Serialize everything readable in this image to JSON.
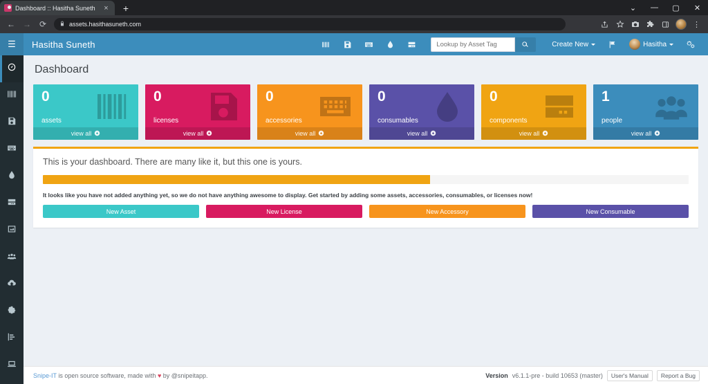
{
  "browser": {
    "tab": {
      "title": "Dashboard :: Hasitha Suneth",
      "favicon": "snipeit-favicon",
      "close": "×"
    },
    "new_tab": "+",
    "window_controls": {
      "minimize_group": "⌄",
      "minimize": "—",
      "maximize": "▢",
      "close": "✕"
    },
    "nav": {
      "back": "←",
      "forward": "→",
      "reload": "⟳"
    },
    "omnibox": {
      "lock": "🔒",
      "url": "assets.hasithasuneth.com"
    },
    "toolbar_icons": [
      "share-icon",
      "bookmark-star-icon",
      "screenshot-camera-icon",
      "extensions-puzzle-icon",
      "side-panel-icon",
      "profile-avatar",
      "chrome-menu-icon"
    ]
  },
  "sidebar": {
    "toggle": {
      "name": "menu-toggle",
      "glyph": "☰"
    },
    "items": [
      {
        "name": "dashboard",
        "icon": "dashboard-speedometer-icon",
        "active": true
      },
      {
        "name": "assets",
        "icon": "barcode-icon",
        "active": false
      },
      {
        "name": "licenses",
        "icon": "floppy-disk-icon",
        "active": false
      },
      {
        "name": "accessories",
        "icon": "keyboard-icon",
        "active": false
      },
      {
        "name": "consumables",
        "icon": "droplet-icon",
        "active": false
      },
      {
        "name": "components",
        "icon": "hard-drive-icon",
        "active": false
      },
      {
        "name": "predefined-kits",
        "icon": "image-frame-icon",
        "active": false
      },
      {
        "name": "people",
        "icon": "users-icon",
        "active": false
      },
      {
        "name": "import",
        "icon": "cloud-upload-icon",
        "active": false
      },
      {
        "name": "settings",
        "icon": "gear-icon",
        "active": false
      },
      {
        "name": "reports",
        "icon": "bar-chart-icon",
        "active": false
      },
      {
        "name": "requestable",
        "icon": "laptop-icon",
        "active": false
      }
    ]
  },
  "header": {
    "brand": "Hasitha Suneth",
    "nav_icons": [
      "assets-barcode-icon",
      "licenses-floppy-icon",
      "accessories-keyboard-icon",
      "consumables-droplet-icon",
      "components-hdd-icon"
    ],
    "search": {
      "placeholder": "Lookup by Asset Tag",
      "value": "",
      "button_icon": "search-icon"
    },
    "create_new": "Create New",
    "alerts_icon": "flag-icon",
    "user": "Hasitha",
    "settings_icon": "gear-cogs-icon"
  },
  "page": {
    "title": "Dashboard"
  },
  "cards": [
    {
      "count": "0",
      "label": "assets",
      "view_all": "view all",
      "icon": "barcode-icon",
      "color": "#3bc8c8",
      "foot_color": "rgba(0,0,0,0.13)"
    },
    {
      "count": "0",
      "label": "licenses",
      "view_all": "view all",
      "icon": "floppy-disk-icon",
      "color": "#d81b60",
      "foot_color": "rgba(0,0,0,0.13)"
    },
    {
      "count": "0",
      "label": "accessories",
      "view_all": "view all",
      "icon": "keyboard-icon",
      "color": "#f7941d",
      "foot_color": "rgba(0,0,0,0.13)"
    },
    {
      "count": "0",
      "label": "consumables",
      "view_all": "view all",
      "icon": "droplet-icon",
      "color": "#5a51a8",
      "foot_color": "rgba(0,0,0,0.13)"
    },
    {
      "count": "0",
      "label": "components",
      "view_all": "view all",
      "icon": "hard-drive-icon",
      "color": "#f0a413",
      "foot_color": "rgba(0,0,0,0.13)"
    },
    {
      "count": "1",
      "label": "people",
      "view_all": "view all",
      "icon": "users-icon",
      "color": "#3c8dbc",
      "foot_color": "rgba(0,0,0,0.13)"
    }
  ],
  "panel": {
    "intro": "This is your dashboard. There are many like it, but this one is yours.",
    "progress_percent": 60,
    "warning": "It looks like you have not added anything yet, so we do not have anything awesome to display. Get started by adding some assets, accessories, consumables, or licenses now!",
    "actions": [
      {
        "label": "New Asset",
        "color": "#3bc8c8"
      },
      {
        "label": "New License",
        "color": "#d81b60"
      },
      {
        "label": "New Accessory",
        "color": "#f7941d"
      },
      {
        "label": "New Consumable",
        "color": "#5a51a8"
      }
    ]
  },
  "footer": {
    "brand_link": "Snipe-IT",
    "text_before": " is open source software, made with ",
    "heart": "♥",
    "text_after": " by @snipeitapp.",
    "version_label": "Version",
    "version_value": "v6.1.1-pre - build 10653 (master)",
    "manual_button": "User's Manual",
    "bug_button": "Report a Bug"
  },
  "colors": {
    "header_blue": "#3c8dbc",
    "sidebar_dark": "#222d32",
    "page_bg": "#ecf0f5",
    "accent_orange": "#f0a413"
  }
}
